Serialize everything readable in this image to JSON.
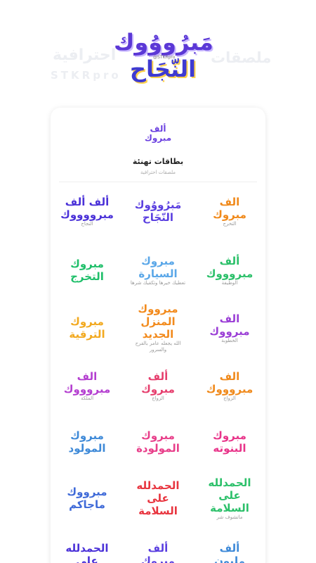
{
  "hero": {
    "bg_text_right": "ملصقات",
    "bg_text_left": "احترافية",
    "bg_text_brand": "STKRpro",
    "logo_line1": "مَبرُووُوك",
    "logo_line2": "النّجَاح",
    "logo_tag": "@STKRpro"
  },
  "pack": {
    "logo_line1": "ألف",
    "logo_line2": "مبروك",
    "title": "بطاقات تهنئة",
    "subtitle": "ملصقات احترافية"
  },
  "stickers": [
    {
      "l1": "ألف ألف",
      "l2": "مبرووووك",
      "l3": "النجاح",
      "color": "#4b32d8"
    },
    {
      "l1": "مَبرُووُوك",
      "l2": "النّجَاح",
      "l3": "",
      "color": "#5a3fe0"
    },
    {
      "l1": "الف",
      "l2": "مبروك",
      "l3": "التخرج",
      "color": "#f08a1c"
    },
    {
      "l1": "مبروك",
      "l2": "التخرج",
      "l3": "",
      "color": "#1fbf6a"
    },
    {
      "l1": "مبروك",
      "l2": "السيارة",
      "l3": "تعطيك خيرها وتكفيك شرها",
      "color": "#5aa7e8"
    },
    {
      "l1": "ألف",
      "l2": "مبروووك",
      "l3": "الوظيفة",
      "color": "#2cc06a"
    },
    {
      "l1": "مبروك",
      "l2": "الترقية",
      "l3": "",
      "color": "#f2a91f"
    },
    {
      "l1": "مبرووك",
      "l2": "المنزل الجديد",
      "l3": "الله يجعله عامر بالفرح والسرور",
      "color": "#f28a1c"
    },
    {
      "l1": "الف",
      "l2": "مبرووك",
      "l3": "الخطوبة",
      "color": "#9b3fd6"
    },
    {
      "l1": "الف",
      "l2": "مبروووك",
      "l3": "الملكة",
      "color": "#b43fd0"
    },
    {
      "l1": "ألف",
      "l2": "مبروك",
      "l3": "الزواج",
      "color": "#e63f6e"
    },
    {
      "l1": "الف",
      "l2": "مبروووك",
      "l3": "الزواج",
      "color": "#f08a1c"
    },
    {
      "l1": "مبروك",
      "l2": "المولود",
      "l3": "",
      "color": "#3f8ad8"
    },
    {
      "l1": "مبروك",
      "l2": "المولودة",
      "l3": "",
      "color": "#e83f8a"
    },
    {
      "l1": "مبروك",
      "l2": "البنوته",
      "l3": "",
      "color": "#e8358a"
    },
    {
      "l1": "مبرووك",
      "l2": "ماجاكم",
      "l3": "",
      "color": "#3f6ad8"
    },
    {
      "l1": "الحمدلله",
      "l2": "على السلامة",
      "l3": "",
      "color": "#e8353f"
    },
    {
      "l1": "الحمدلله",
      "l2": "على السلامة",
      "l3": "ماتشوف شر",
      "color": "#2cc06a"
    },
    {
      "l1": "الحمدلله",
      "l2": "على",
      "l3": "",
      "color": "#4b32d8"
    },
    {
      "l1": "ألف",
      "l2": "مبروك",
      "l3": "",
      "color": "#5a3fe0"
    },
    {
      "l1": "ألف",
      "l2": "مليون",
      "l3": "",
      "color": "#3f8ad8"
    }
  ]
}
